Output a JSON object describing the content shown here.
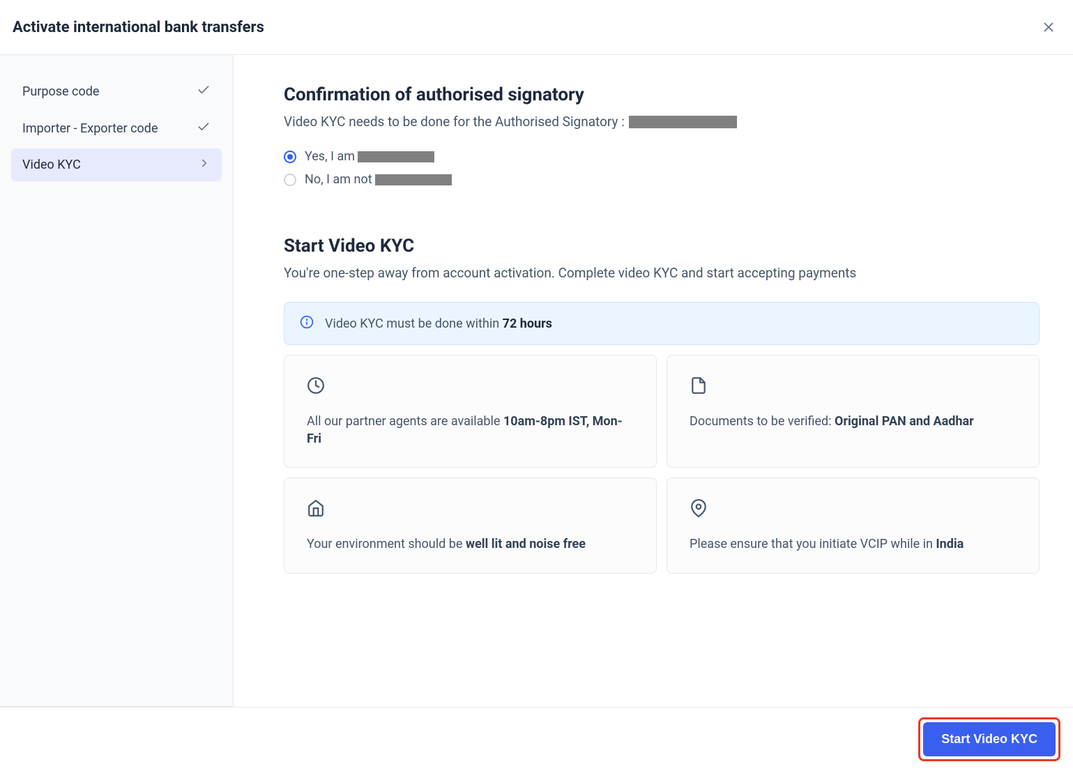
{
  "header": {
    "title": "Activate international bank transfers"
  },
  "sidebar": {
    "items": [
      {
        "label": "Purpose code",
        "status": "done"
      },
      {
        "label": "Importer - Exporter code",
        "status": "done"
      },
      {
        "label": "Video KYC",
        "status": "active"
      }
    ]
  },
  "confirmation": {
    "title": "Confirmation of authorised signatory",
    "subtitle": "Video KYC needs to be done for the Authorised Signatory :",
    "options": {
      "yes_prefix": "Yes, I am ",
      "no_prefix": "No, I am not "
    },
    "selected": "yes"
  },
  "start": {
    "title": "Start Video KYC",
    "subtitle": "You're one-step away from account activation. Complete video KYC and start accepting payments",
    "banner_prefix": "Video KYC must be done within ",
    "banner_bold": "72 hours",
    "cards": [
      {
        "prefix": "All our partner agents are available ",
        "bold": "10am-8pm IST, Mon-Fri"
      },
      {
        "prefix": "Documents to be verified: ",
        "bold": "Original PAN and Aadhar"
      },
      {
        "prefix": "Your environment should be ",
        "bold": "well lit and noise free"
      },
      {
        "prefix": "Please ensure that you initiate VCIP while in ",
        "bold": "India"
      }
    ]
  },
  "footer": {
    "cta": "Start Video KYC"
  }
}
